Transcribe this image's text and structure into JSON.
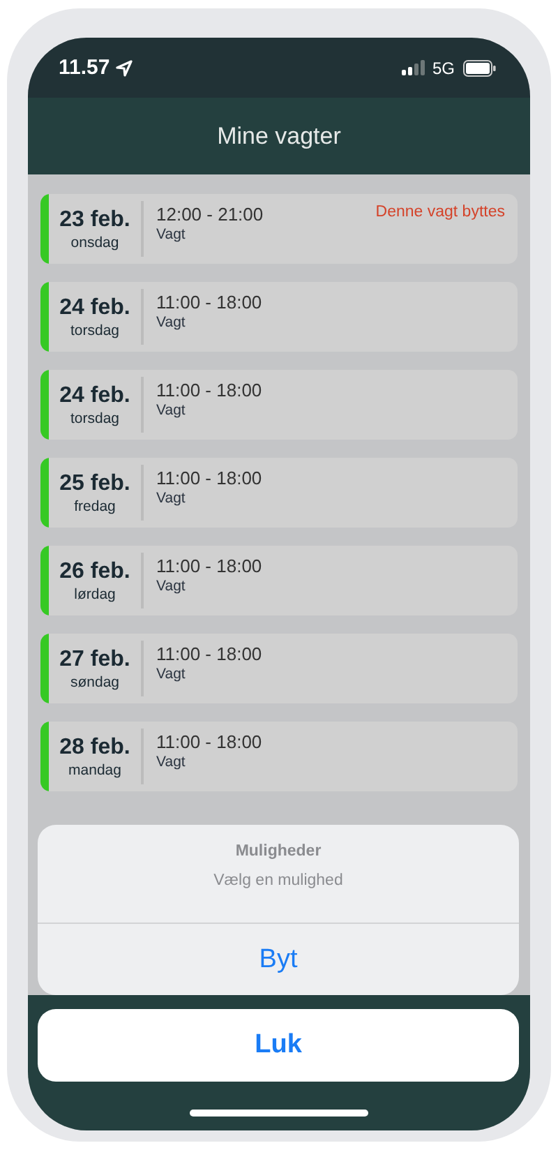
{
  "status_bar": {
    "time": "11.57",
    "network": "5G"
  },
  "header": {
    "title": "Mine vagter"
  },
  "shifts": [
    {
      "date": "23 feb.",
      "weekday": "onsdag",
      "time": "12:00 - 21:00",
      "type": "Vagt",
      "note": "Denne vagt byttes"
    },
    {
      "date": "24 feb.",
      "weekday": "torsdag",
      "time": "11:00 - 18:00",
      "type": "Vagt"
    },
    {
      "date": "24 feb.",
      "weekday": "torsdag",
      "time": "11:00 - 18:00",
      "type": "Vagt"
    },
    {
      "date": "25 feb.",
      "weekday": "fredag",
      "time": "11:00 - 18:00",
      "type": "Vagt"
    },
    {
      "date": "26 feb.",
      "weekday": "lørdag",
      "time": "11:00 - 18:00",
      "type": "Vagt"
    },
    {
      "date": "27 feb.",
      "weekday": "søndag",
      "time": "11:00 - 18:00",
      "type": "Vagt"
    },
    {
      "date": "28 feb.",
      "weekday": "mandag",
      "time": "11:00 - 18:00",
      "type": "Vagt"
    }
  ],
  "action_sheet": {
    "title": "Muligheder",
    "message": "Vælg en mulighed",
    "actions": [
      "Byt"
    ],
    "cancel": "Luk"
  }
}
